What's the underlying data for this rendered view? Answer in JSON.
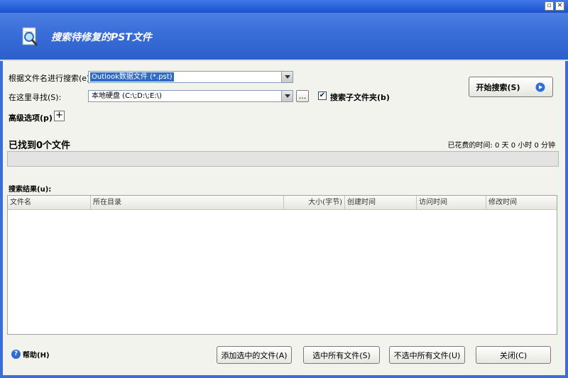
{
  "window": {
    "title": "搜索待修复的PST文件",
    "min_glyph": "▫",
    "close_glyph": "✕"
  },
  "search_by_name": {
    "label": "根据文件名进行搜索(e):",
    "value": "Outlook数据文件 (*.pst)"
  },
  "search_in": {
    "label": "在这里寻找(S):",
    "value": "本地硬盘 (C:\\;D:\\;E:\\)",
    "browse_label": "..."
  },
  "subfolders": {
    "label": "搜索子文件夹(b)",
    "checked": true,
    "check_glyph": "✔"
  },
  "start_button": {
    "label": "开始搜索(S)"
  },
  "advanced": {
    "label": "高级选项(p)",
    "plus_glyph": "+"
  },
  "status": {
    "found_text": "已找到0个文件",
    "elapsed_text": "已花费的时间: 0 天 0 小时 0 分钟",
    "progress": 0
  },
  "results": {
    "label": "搜索结果(u):",
    "columns": [
      "文件名",
      "所在目录",
      "大小(字节)",
      "创建时间",
      "访问时间",
      "修改时间"
    ],
    "rows": []
  },
  "footer": {
    "help_label": "帮助(H)",
    "help_glyph": "?",
    "add_selected": "添加选中的文件(A)",
    "select_all": "选中所有文件(S)",
    "deselect_all": "不选中所有文件(U)",
    "close": "关闭(C)"
  },
  "colors": {
    "header": "#3a6ed9",
    "selection": "#316ac5",
    "accent_icon": "#2c6bd8"
  }
}
